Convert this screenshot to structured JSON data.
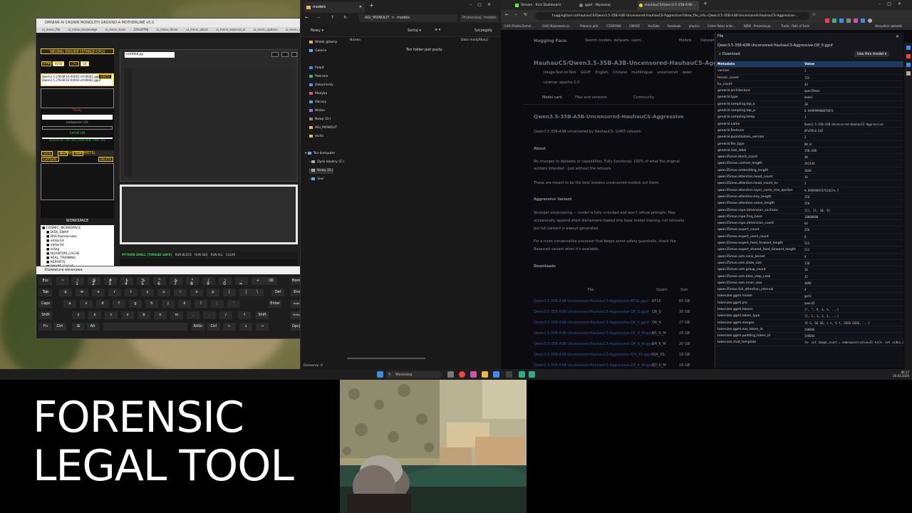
{
  "left_app": {
    "title": "OMNIAN AI CROWN MONOLITH GROUND-A MOTHERLINE v5.0",
    "menu": [
      "ui_menu_file",
      "ui_menu_knowledge",
      "ui_menu_tools",
      "ZAKLEPNIJ",
      "ui_menu_flavor",
      "ui_menu_about",
      "ui_menu_external_ui",
      "ui_menu_options",
      "ui_menu_window"
    ],
    "engine_label": "NEURAL ENGINE [STABLE-CPU]",
    "ctx_label": "CTX",
    "ctx_value": "4096",
    "cpu_label": "CPU",
    "cpu_value": "16",
    "stable_cpu": "[STABLE CPU]",
    "ignite": "IGNITE",
    "models": [
      "Qwen3.5-27B-BF16-00001-of-00002.gguf",
      "Qwen3.5-27B-BF16-00002-of-00002.gguf"
    ],
    "status_red": "Ready",
    "loading": "Ładowanie: 0%",
    "cache_on": "CACHE ON",
    "health": "HEALTH OK | CPU 16% | RAM 8GB | FREE 23%",
    "safe": "SAFE",
    "bal": "BAL",
    "max": "MAX",
    "quarks": "QUARKS (SNIPPETS)",
    "capture": "CAPTURE",
    "delete": "DELETE",
    "workspace": "WORKSPACE",
    "workspace_items": [
      "COSMIC_WORKSPACE",
      "DISK_SWAP",
      "Dtilt-Kwazonator",
      "editor2d",
      "editor3d",
      "m4zg",
      "QUANTUM_CACHE",
      "REAL_TRAINING",
      "REPORTS",
      "SMART_CACHE"
    ],
    "refresh": "REFRESH FILES",
    "editor_tab": "untitled.py",
    "shell": "PYTHON SHELL [THREAD SAFE]",
    "shell_btns": [
      "RUN BLOCK",
      "RUN SEQ",
      "RUN ALL",
      "CLEAR"
    ]
  },
  "keyboard": {
    "title": "Klawiatura ekranowa",
    "rows": [
      [
        "Esc",
        "~",
        "!",
        "@",
        "#",
        "$",
        "%",
        "^",
        "&",
        "*",
        "(",
        ")",
        "-",
        "+",
        "⌫",
        "Home",
        "PgUp",
        "Nav"
      ],
      [
        "Tab",
        "q",
        "w",
        "e",
        "r",
        "t",
        "y",
        "u",
        "i",
        "o",
        "p",
        "[",
        "]",
        "\\",
        "Del",
        "End",
        "PgDn",
        "Przenieś"
      ],
      [
        "Caps",
        "a",
        "s",
        "d",
        "f",
        "g",
        "h",
        "j",
        "k",
        "l",
        ";",
        "'",
        "Enter",
        "Insert",
        "Pause",
        "Przyciemnij"
      ],
      [
        "Shift",
        "z",
        "x",
        "c",
        "v",
        "b",
        "n",
        "m",
        ",",
        ".",
        "/",
        "↑",
        "Shift",
        "PrtScn",
        "ScrLk",
        "Zadokuj"
      ],
      [
        "Fn",
        "Ctrl",
        "⊞",
        "Alt",
        "AltGr",
        "Ctrl",
        "←",
        "↓",
        "→",
        "Opcje",
        "Pomoc",
        "Zanikanie"
      ]
    ],
    "numrow": [
      "1",
      "2",
      "3",
      "4",
      "5",
      "6",
      "7",
      "8",
      "9",
      "0",
      "="
    ]
  },
  "explorer": {
    "tab": "models",
    "path_segments": [
      "AGI_MONOLIT",
      ">",
      "models"
    ],
    "search_placeholder": "Przeszukaj: models",
    "new_label": "Nowy",
    "sort_label": "Sortuj",
    "view_label": "Wyświetl",
    "details_label": "Szczegóły",
    "nav": [
      "Widok główny",
      "Galeria",
      "Pulpit",
      "Pobrane",
      "Dokumenty",
      "Muzyka",
      "Obrazy",
      "Wideo",
      "Nowy (D:)",
      "AGI_MONOLIT",
      "skrits",
      "Ten komputer",
      "Dysk lokalny (C:)",
      "Nowy (D:)",
      "Sieć"
    ],
    "col_name": "Nazwa",
    "col_date": "Data modyfikacji",
    "empty": "Ten folder jest pusty.",
    "status": "Elementy: 0"
  },
  "browser": {
    "tabs": [
      "Stream - Kick Dashboard",
      "gguf - Wyszukaj",
      "HauhauCS/Qwen3.5-35B-A3B-..."
    ],
    "url": "huggingface.co/HauhauCS/Qwen3.5-35B-A3B-Uncensored-HauhauCS-Aggressive?show_file_info=Qwen3.5-35B-A3B-Uncensored-HauhauCS-Aggressive-...",
    "bookmarks": [
      "(146) Piasta Demol...",
      "(144) Najnowsze pr...",
      "Pobrane pliki",
      "CZOZONO",
      "CINYOX",
      "YouTube",
      "Facebook",
      "physics",
      "Cinter Poker onlin...",
      "XJEW - Prezentacje...",
      "Trade - Path of Exile",
      "Wszystkie zakładki"
    ],
    "hf_logo": "Hugging Face",
    "hf_search": "Search models, datasets, users...",
    "hf_nav": [
      "Models",
      "Datasets"
    ],
    "repo_title": "HauhauCS/Qwen3.5-35B-A3B-Uncensored-HauhauCS-Aggressive",
    "repo_tags": [
      "Image-Text-to-Text",
      "GGUF",
      "English",
      "Chinese",
      "multilingual",
      "uncensored",
      "qwen"
    ],
    "repo_license": "License: apache-2.0",
    "repo_tabs": [
      "Model card",
      "Files and versions",
      "Community"
    ],
    "h1": "Qwen3.5-35B-A3B-Uncensored-HauhauCS-Aggressive",
    "intro": "Qwen3.5-35B-A3B uncensored by HauhauCS. 0/465 refusals.",
    "about_h": "About",
    "about_p1": "No changes to datasets or capabilities. Fully functional, 100% of what the original",
    "about_p2": "authors intended - just without the refusals.",
    "about_p3": "These are meant to be the best lossless uncensored models out there.",
    "aggr_h": "Aggressive Variant",
    "aggr_p1": "Stronger uncensoring — model is fully unlocked and won't refuse prompts. May",
    "aggr_p2": "occasionally append short disclaimers (baked into base model training, not refusals)",
    "aggr_p3": "but full content is always generated.",
    "aggr_p4": "For a more conservative uncensor that keeps some safety guardrails, check the",
    "aggr_p5": "Balanced variant when it's available.",
    "downloads_h": "Downloads",
    "dl_cols": [
      "File",
      "Quant",
      "Size"
    ],
    "dl_rows": [
      [
        "Qwen3.5-35B-A3B-Uncensored-HauhauCS-Aggressive-BF16.gguf",
        "BF16",
        "65 GB"
      ],
      [
        "Qwen3.5-35B-A3B-Uncensored-HauhauCS-Aggressive-Q8_0.gguf",
        "Q8_0",
        "35 GB"
      ],
      [
        "Qwen3.5-35B-A3B-Uncensored-HauhauCS-Aggressive-Q6_K.gguf",
        "Q6_K",
        "27 GB"
      ],
      [
        "Qwen3.5-35B-A3B-Uncensored-HauhauCS-Aggressive-Q5_K_M.gguf",
        "Q5_K_M",
        "23 GB"
      ],
      [
        "Qwen3.5-35B-A3B-Uncensored-HauhauCS-Aggressive-Q4_K_M.gguf",
        "Q4_K_M",
        "20 GB"
      ],
      [
        "Qwen3.5-35B-A3B-Uncensored-HauhauCS-Aggressive-IQ4_XS.gguf",
        "IQ4_XS",
        "18 GB"
      ],
      [
        "Qwen3.5-35B-A3B-Uncensored-HauhauCS-Aggressive-Q3_K_M.gguf",
        "Q3_K_M",
        "16 GB"
      ]
    ],
    "panel_label": "File",
    "panel_file": "Qwen3.5-35B-A3B-Uncensored-HauhauCS-Aggressive-Q8_0.gguf",
    "panel_download": "Download",
    "panel_use": "Use this model",
    "meta_col_k": "Metadata",
    "meta_col_v": "Value",
    "metadata": [
      [
        "version",
        "3"
      ],
      [
        "tensor_count",
        "733"
      ],
      [
        "kv_count",
        "43"
      ],
      [
        "general.architecture",
        "qwen35moe"
      ],
      [
        "general.type",
        "model"
      ],
      [
        "general.sampling.top_k",
        "20"
      ],
      [
        "general.sampling.top_p",
        "0.949999988079071"
      ],
      [
        "general.sampling.temp",
        "1"
      ],
      [
        "general.name",
        "Qwen3.5-35B-A3B-Uncensored-HauhauCS-Aggressive"
      ],
      [
        "general.finetune",
        "6Fa5RL0.642"
      ],
      [
        "general.quantization_version",
        "2"
      ],
      [
        "general.file_type",
        "Q8_0"
      ],
      [
        "general.size_label",
        "35B-A3B"
      ],
      [
        "qwen35moe.block_count",
        "40"
      ],
      [
        "qwen35moe.context_length",
        "262144"
      ],
      [
        "qwen35moe.embedding_length",
        "2048"
      ],
      [
        "qwen35moe.attention.head_count",
        "16"
      ],
      [
        "qwen35moe.attention.head_count_kv",
        "2"
      ],
      [
        "qwen35moe.attention.layer_norm_rms_epsilon",
        "9.999999974752427e-7"
      ],
      [
        "qwen35moe.attention.key_length",
        "256"
      ],
      [
        "qwen35moe.attention.value_length",
        "256"
      ],
      [
        "qwen35moe.rope.dimension_sections",
        "[11, 11, 10, 0]"
      ],
      [
        "qwen35moe.rope.freq_base",
        "10000000"
      ],
      [
        "qwen35moe.rope.dimension_count",
        "64"
      ],
      [
        "qwen35moe.expert_count",
        "256"
      ],
      [
        "qwen35moe.expert_used_count",
        "8"
      ],
      [
        "qwen35moe.expert_feed_forward_length",
        "512"
      ],
      [
        "qwen35moe.expert_shared_feed_forward_length",
        "512"
      ],
      [
        "qwen35moe.ssm.conv_kernel",
        "4"
      ],
      [
        "qwen35moe.ssm.state_size",
        "128"
      ],
      [
        "qwen35moe.ssm.group_count",
        "16"
      ],
      [
        "qwen35moe.ssm.time_step_rank",
        "32"
      ],
      [
        "qwen35moe.ssm.inner_size",
        "4096"
      ],
      [
        "qwen35moe.full_attention_interval",
        "4"
      ],
      [
        "tokenizer.ggml.model",
        "gpt2"
      ],
      [
        "tokenizer.ggml.pre",
        "qwen35"
      ],
      [
        "tokenizer.ggml.tokens",
        "[!, \", #, $, %, ...]"
      ],
      [
        "tokenizer.ggml.token_type",
        "[1, 1, 1, 1, 1, ...]"
      ],
      [
        "tokenizer.ggml.merges",
        "[Ġ Ġ, ĠĠ ĠĠ, i n, Ġ t, ĠĠĠĠ ĠĠĠĠ, ...]"
      ],
      [
        "tokenizer.ggml.eos_token_id",
        "248046"
      ],
      [
        "tokenizer.ggml.padding_token_id",
        "248044"
      ],
      [
        "tokenizer.chat_template",
        "{%- set image_count = namespace(value=0) %}{%- set video_count = namespace(value=0) %}"
      ]
    ]
  },
  "taskbar": {
    "search": "Wyszukaj",
    "time": "00:17",
    "date": "20.03.2026"
  },
  "caption": {
    "line1": "FORENSIC",
    "line2": "LEGAL TOOL"
  }
}
